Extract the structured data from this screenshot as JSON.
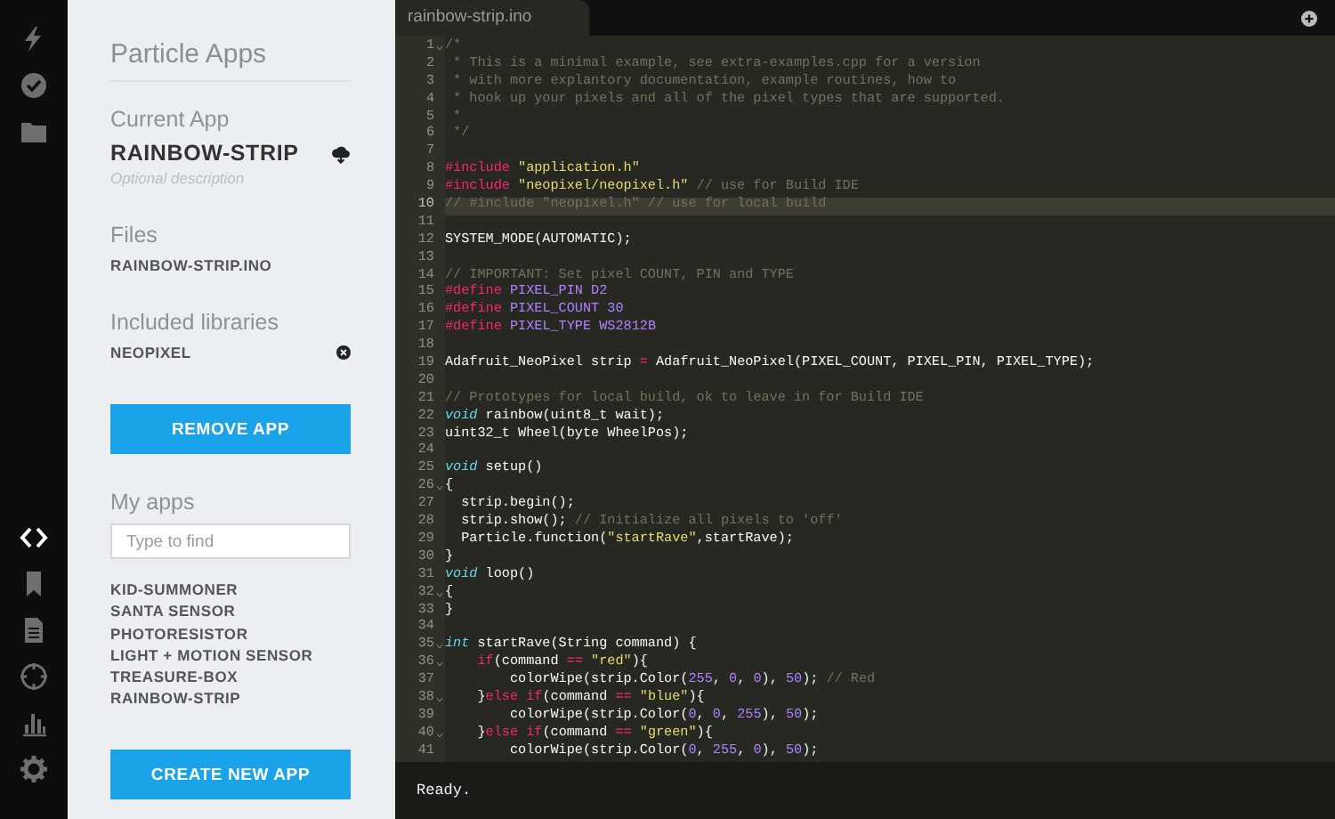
{
  "nav": [
    {
      "kind": "bolt",
      "selected": false
    },
    {
      "kind": "check",
      "selected": false
    },
    {
      "kind": "folder",
      "selected": false
    },
    {
      "kind": "code",
      "selected": true
    },
    {
      "kind": "bookmark",
      "selected": false
    },
    {
      "kind": "document",
      "selected": false
    },
    {
      "kind": "crosshair",
      "selected": false
    },
    {
      "kind": "chart",
      "selected": false
    },
    {
      "kind": "gear",
      "selected": false
    }
  ],
  "sidebar": {
    "title": "Particle Apps",
    "current_app": {
      "heading": "Current App",
      "name": "RAINBOW-STRIP",
      "description_placeholder": "Optional description"
    },
    "files": {
      "heading": "Files",
      "items": [
        "RAINBOW-STRIP.INO"
      ]
    },
    "libraries": {
      "heading": "Included libraries",
      "items": [
        "NEOPIXEL"
      ]
    },
    "remove_button": "REMOVE APP",
    "my_apps": {
      "heading": "My apps",
      "search": {
        "placeholder": "Type to find"
      },
      "items": [
        "KID-SUMMONER",
        "SANTA SENSOR",
        "PHOTORESISTOR",
        "LIGHT + MOTION SENSOR",
        "TREASURE-BOX",
        "RAINBOW-STRIP"
      ]
    },
    "create_button": "CREATE NEW APP"
  },
  "editor": {
    "tab": "rainbow-strip.ino",
    "lines": [
      {
        "number": "1",
        "fold": true,
        "active": false,
        "tokens": [
          {
            "kind": "comment",
            "text": "/*"
          }
        ]
      },
      {
        "number": "2",
        "fold": false,
        "active": false,
        "tokens": [
          {
            "kind": "comment",
            "text": " * This is a minimal example, see extra-examples.cpp for a version"
          }
        ]
      },
      {
        "number": "3",
        "fold": false,
        "active": false,
        "tokens": [
          {
            "kind": "comment",
            "text": " * with more explantory documentation, example routines, how to"
          }
        ]
      },
      {
        "number": "4",
        "fold": false,
        "active": false,
        "tokens": [
          {
            "kind": "comment",
            "text": " * hook up your pixels and all of the pixel types that are supported."
          }
        ]
      },
      {
        "number": "5",
        "fold": false,
        "active": false,
        "tokens": [
          {
            "kind": "comment",
            "text": " *"
          }
        ]
      },
      {
        "number": "6",
        "fold": false,
        "active": false,
        "tokens": [
          {
            "kind": "comment",
            "text": " */"
          }
        ]
      },
      {
        "number": "7",
        "fold": false,
        "active": false
      },
      {
        "number": "8",
        "fold": false,
        "active": false,
        "tokens": [
          {
            "kind": "keyword",
            "text": "#include "
          },
          {
            "kind": "string",
            "text": "\"application.h\""
          }
        ]
      },
      {
        "number": "9",
        "fold": false,
        "active": false,
        "tokens": [
          {
            "kind": "keyword",
            "text": "#include "
          },
          {
            "kind": "string",
            "text": "\"neopixel/neopixel.h\""
          },
          {
            "kind": "comment",
            "text": " // use for Build IDE"
          }
        ]
      },
      {
        "number": "10",
        "fold": false,
        "active": true,
        "tokens": [
          {
            "kind": "comment",
            "text": "// #include \"neopixel.h\" // use for local build"
          }
        ]
      },
      {
        "number": "11",
        "fold": false,
        "active": false
      },
      {
        "number": "12",
        "fold": false,
        "active": false,
        "tokens": [
          {
            "kind": "plain",
            "text": "SYSTEM_MODE(AUTOMATIC);"
          }
        ]
      },
      {
        "number": "13",
        "fold": false,
        "active": false
      },
      {
        "number": "14",
        "fold": false,
        "active": false,
        "tokens": [
          {
            "kind": "comment",
            "text": "// IMPORTANT: Set pixel COUNT, PIN and TYPE"
          }
        ]
      },
      {
        "number": "15",
        "fold": false,
        "active": false,
        "tokens": [
          {
            "kind": "keyword",
            "text": "#define "
          },
          {
            "kind": "constant",
            "text": "PIXEL_PIN D2"
          }
        ]
      },
      {
        "number": "16",
        "fold": false,
        "active": false,
        "tokens": [
          {
            "kind": "keyword",
            "text": "#define "
          },
          {
            "kind": "constant",
            "text": "PIXEL_COUNT 30"
          }
        ]
      },
      {
        "number": "17",
        "fold": false,
        "active": false,
        "tokens": [
          {
            "kind": "keyword",
            "text": "#define "
          },
          {
            "kind": "constant",
            "text": "PIXEL_TYPE WS2812B"
          }
        ]
      },
      {
        "number": "18",
        "fold": false,
        "active": false
      },
      {
        "number": "19",
        "fold": false,
        "active": false,
        "tokens": [
          {
            "kind": "plain",
            "text": "Adafruit_NeoPixel strip "
          },
          {
            "kind": "keyword",
            "text": "="
          },
          {
            "kind": "plain",
            "text": " Adafruit_NeoPixel(PIXEL_COUNT, PIXEL_PIN, PIXEL_TYPE);"
          }
        ]
      },
      {
        "number": "20",
        "fold": false,
        "active": false
      },
      {
        "number": "21",
        "fold": false,
        "active": false,
        "tokens": [
          {
            "kind": "comment",
            "text": "// Prototypes for local build, ok to leave in for Build IDE"
          }
        ]
      },
      {
        "number": "22",
        "fold": false,
        "active": false,
        "tokens": [
          {
            "kind": "type",
            "text": "void"
          },
          {
            "kind": "plain",
            "text": " rainbow(uint8_t wait);"
          }
        ]
      },
      {
        "number": "23",
        "fold": false,
        "active": false,
        "tokens": [
          {
            "kind": "plain",
            "text": "uint32_t Wheel(byte WheelPos);"
          }
        ]
      },
      {
        "number": "24",
        "fold": false,
        "active": false
      },
      {
        "number": "25",
        "fold": false,
        "active": false,
        "tokens": [
          {
            "kind": "type",
            "text": "void"
          },
          {
            "kind": "plain",
            "text": " setup()"
          }
        ]
      },
      {
        "number": "26",
        "fold": true,
        "active": false,
        "tokens": [
          {
            "kind": "plain",
            "text": "{"
          }
        ]
      },
      {
        "number": "27",
        "fold": false,
        "active": false,
        "tokens": [
          {
            "kind": "plain",
            "text": "  strip.begin();"
          }
        ]
      },
      {
        "number": "28",
        "fold": false,
        "active": false,
        "tokens": [
          {
            "kind": "plain",
            "text": "  strip.show(); "
          },
          {
            "kind": "comment",
            "text": "// Initialize all pixels to 'off'"
          }
        ]
      },
      {
        "number": "29",
        "fold": false,
        "active": false,
        "tokens": [
          {
            "kind": "plain",
            "text": "  Particle.function("
          },
          {
            "kind": "string",
            "text": "\"startRave\""
          },
          {
            "kind": "plain",
            "text": ",startRave);"
          }
        ]
      },
      {
        "number": "30",
        "fold": false,
        "active": false,
        "tokens": [
          {
            "kind": "plain",
            "text": "}"
          }
        ]
      },
      {
        "number": "31",
        "fold": false,
        "active": false,
        "tokens": [
          {
            "kind": "type",
            "text": "void"
          },
          {
            "kind": "plain",
            "text": " loop()"
          }
        ]
      },
      {
        "number": "32",
        "fold": true,
        "active": false,
        "tokens": [
          {
            "kind": "plain",
            "text": "{"
          }
        ]
      },
      {
        "number": "33",
        "fold": false,
        "active": false,
        "tokens": [
          {
            "kind": "plain",
            "text": "}"
          }
        ]
      },
      {
        "number": "34",
        "fold": false,
        "active": false
      },
      {
        "number": "35",
        "fold": true,
        "active": false,
        "tokens": [
          {
            "kind": "type",
            "text": "int"
          },
          {
            "kind": "plain",
            "text": " startRave(String command) {"
          }
        ]
      },
      {
        "number": "36",
        "fold": true,
        "active": false,
        "tokens": [
          {
            "kind": "keyword",
            "text": "    if"
          },
          {
            "kind": "plain",
            "text": "(command "
          },
          {
            "kind": "keyword",
            "text": "== "
          },
          {
            "kind": "string",
            "text": "\"red\""
          },
          {
            "kind": "plain",
            "text": "){"
          }
        ]
      },
      {
        "number": "37",
        "fold": false,
        "active": false,
        "tokens": [
          {
            "kind": "plain",
            "text": "        colorWipe(strip.Color("
          },
          {
            "kind": "constant",
            "text": "255"
          },
          {
            "kind": "plain",
            "text": ", "
          },
          {
            "kind": "constant",
            "text": "0"
          },
          {
            "kind": "plain",
            "text": ", "
          },
          {
            "kind": "constant",
            "text": "0"
          },
          {
            "kind": "plain",
            "text": "), "
          },
          {
            "kind": "constant",
            "text": "50"
          },
          {
            "kind": "plain",
            "text": "); "
          },
          {
            "kind": "comment",
            "text": "// Red"
          }
        ]
      },
      {
        "number": "38",
        "fold": true,
        "active": false,
        "tokens": [
          {
            "kind": "plain",
            "text": "    }"
          },
          {
            "kind": "keyword",
            "text": "else if"
          },
          {
            "kind": "plain",
            "text": "(command "
          },
          {
            "kind": "keyword",
            "text": "== "
          },
          {
            "kind": "string",
            "text": "\"blue\""
          },
          {
            "kind": "plain",
            "text": "){"
          }
        ]
      },
      {
        "number": "39",
        "fold": false,
        "active": false,
        "tokens": [
          {
            "kind": "plain",
            "text": "        colorWipe(strip.Color("
          },
          {
            "kind": "constant",
            "text": "0"
          },
          {
            "kind": "plain",
            "text": ", "
          },
          {
            "kind": "constant",
            "text": "0"
          },
          {
            "kind": "plain",
            "text": ", "
          },
          {
            "kind": "constant",
            "text": "255"
          },
          {
            "kind": "plain",
            "text": "), "
          },
          {
            "kind": "constant",
            "text": "50"
          },
          {
            "kind": "plain",
            "text": ");"
          }
        ]
      },
      {
        "number": "40",
        "fold": true,
        "active": false,
        "tokens": [
          {
            "kind": "plain",
            "text": "    }"
          },
          {
            "kind": "keyword",
            "text": "else if"
          },
          {
            "kind": "plain",
            "text": "(command "
          },
          {
            "kind": "keyword",
            "text": "== "
          },
          {
            "kind": "string",
            "text": "\"green\""
          },
          {
            "kind": "plain",
            "text": "){"
          }
        ]
      },
      {
        "number": "41",
        "fold": false,
        "active": false,
        "tokens": [
          {
            "kind": "plain",
            "text": "        colorWipe(strip.Color("
          },
          {
            "kind": "constant",
            "text": "0"
          },
          {
            "kind": "plain",
            "text": ", "
          },
          {
            "kind": "constant",
            "text": "255"
          },
          {
            "kind": "plain",
            "text": ", "
          },
          {
            "kind": "constant",
            "text": "0"
          },
          {
            "kind": "plain",
            "text": "), "
          },
          {
            "kind": "constant",
            "text": "50"
          },
          {
            "kind": "plain",
            "text": ");"
          }
        ]
      }
    ]
  },
  "status_bar": "Ready."
}
